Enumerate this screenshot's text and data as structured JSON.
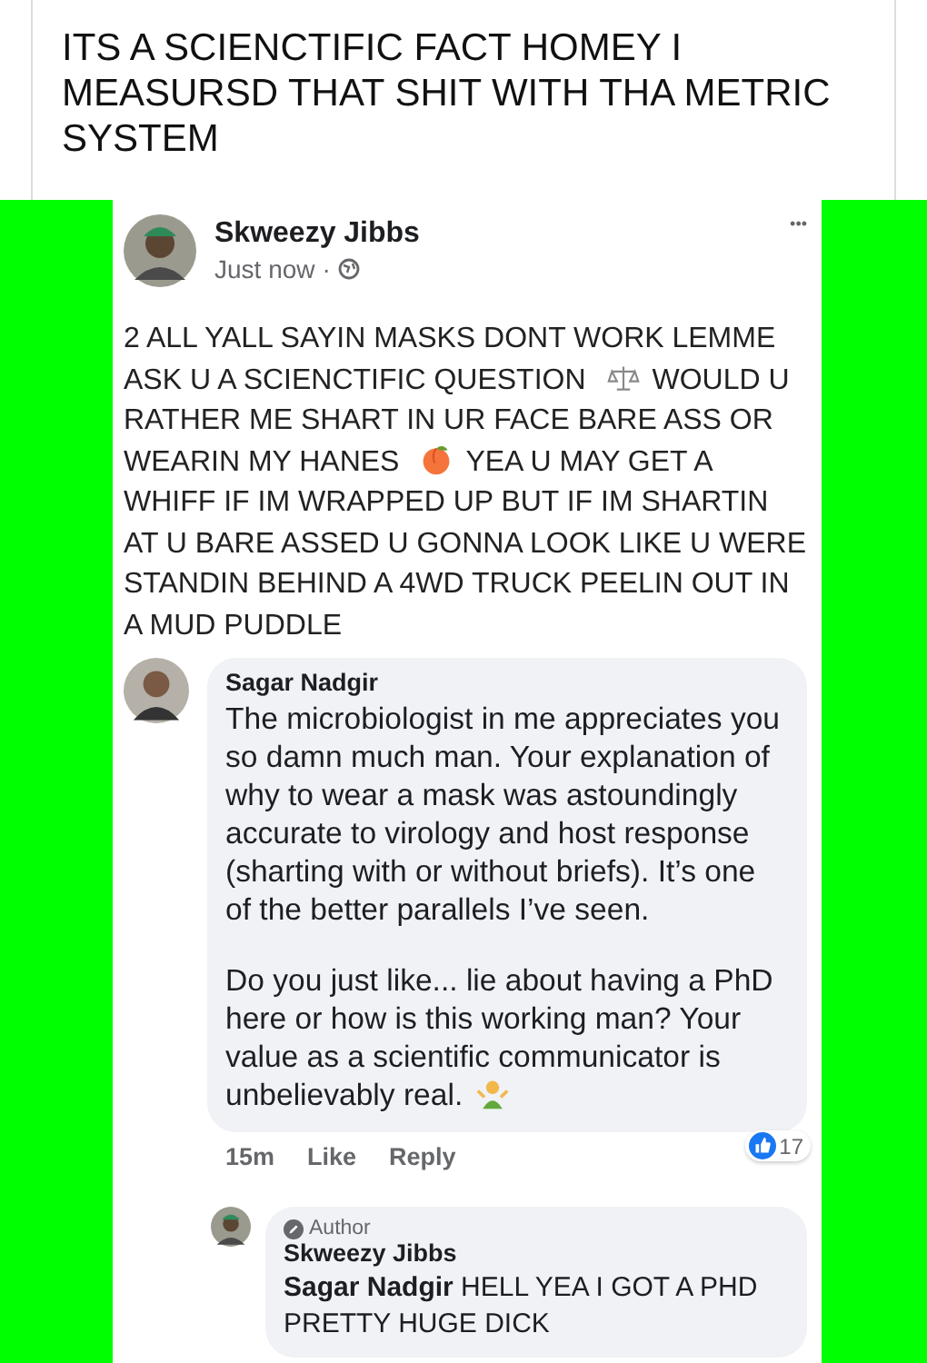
{
  "caption": "ITS A SCIENCTIFIC FACT HOMEY I MEASURSD THAT SHIT WITH THA METRIC SYSTEM",
  "post": {
    "author": "Skweezy Jibbs",
    "time": "Just now",
    "separator": "·",
    "more": "•••",
    "text_parts": [
      "2 ALL YALL SAYIN MASKS DONT WORK LEMME ASK U A SCIENCTIFIC QUESTION",
      "WOULD U RATHER ME SHART IN UR FACE BARE ASS OR WEARIN MY HANES",
      "YEA U MAY GET A WHIFF IF IM WRAPPED UP BUT IF IM SHARTIN AT U BARE ASSED U GONNA LOOK LIKE U WERE STANDIN BEHIND A 4WD TRUCK PEELIN OUT IN A MUD PUDDLE"
    ]
  },
  "comment": {
    "author": "Sagar Nadgir",
    "paragraphs": [
      "The microbiologist in me appreciates you so damn much man. Your explanation of why to wear a mask was astoundingly accurate to virology and host response (sharting with or without briefs). It’s one of the better parallels I’ve seen.",
      "Do you just like... lie about having a PhD here or how is this working man? Your value as a scientific communicator is unbelievably real."
    ],
    "time": "15m",
    "actions": [
      "Like",
      "Reply"
    ],
    "reaction_count": "17"
  },
  "reply": {
    "badge": "Author",
    "author": "Skweezy Jibbs",
    "text": "**Sagar Nadgir** HELL YEA I GOT A PHD PRETTY HUGE DICK"
  }
}
